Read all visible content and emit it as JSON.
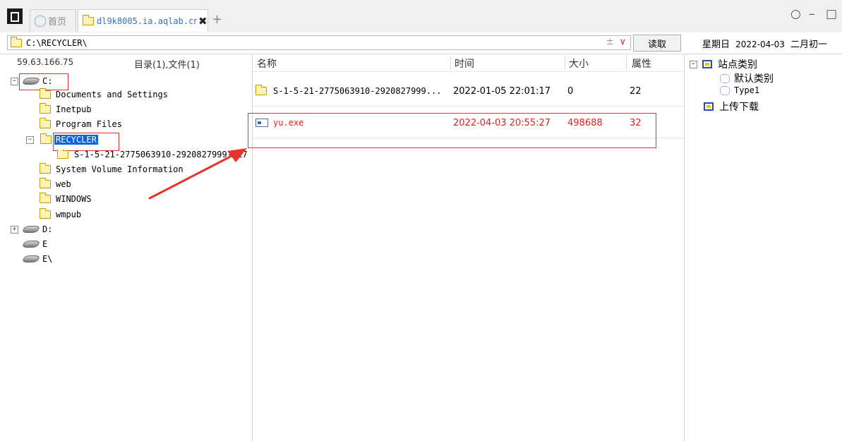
{
  "tabs": {
    "home_label": "首页",
    "active_label": "dl9k8005.ia.aqlab.cn",
    "add_label": "+"
  },
  "window": {
    "circle": "○",
    "minimize": "–",
    "maximize": "□"
  },
  "address": {
    "path": "C:\\RECYCLER\\",
    "plusminus": "±",
    "dropdown": "∨"
  },
  "toolbar": {
    "read_label": "读取"
  },
  "date": {
    "weekday": "星期日",
    "date": "2022-04-03",
    "lunar": "二月初一"
  },
  "left": {
    "ip": "59.63.166.75",
    "counts": "目录(1),文件(1)"
  },
  "columns": {
    "name": "名称",
    "time": "时间",
    "size": "大小",
    "attr": "属性"
  },
  "tree": {
    "drive_c": "C:",
    "items_c": [
      "Documents and Settings",
      "Inetpub",
      "Program Files"
    ],
    "recycler": "RECYCLER",
    "sid": "S-1-5-21-2775063910-2920827999-217",
    "items_c2": [
      "System Volume Information",
      "web",
      "WINDOWS",
      "wmpub"
    ],
    "drive_d": "D:",
    "drive_e": "E",
    "drive_e2": "E\\",
    "expand_minus": "−",
    "expand_plus": "+"
  },
  "files": [
    {
      "name": "S-1-5-21-2775063910-2920827999...",
      "time": "2022-01-05 22:01:17",
      "size": "0",
      "attr": "22"
    },
    {
      "name": "yu.exe",
      "time": "2022-04-03 20:55:27",
      "size": "498688",
      "attr": "32"
    }
  ],
  "right": {
    "site_category": "站点类别",
    "default_category": "默认类别",
    "type1": "Type1",
    "upload_download": "上传下载",
    "expand_minus": "−"
  },
  "colors": {
    "highlight_red": "#e02020",
    "selection_blue": "#0a64d8",
    "annotation_red": "#e8332a"
  }
}
